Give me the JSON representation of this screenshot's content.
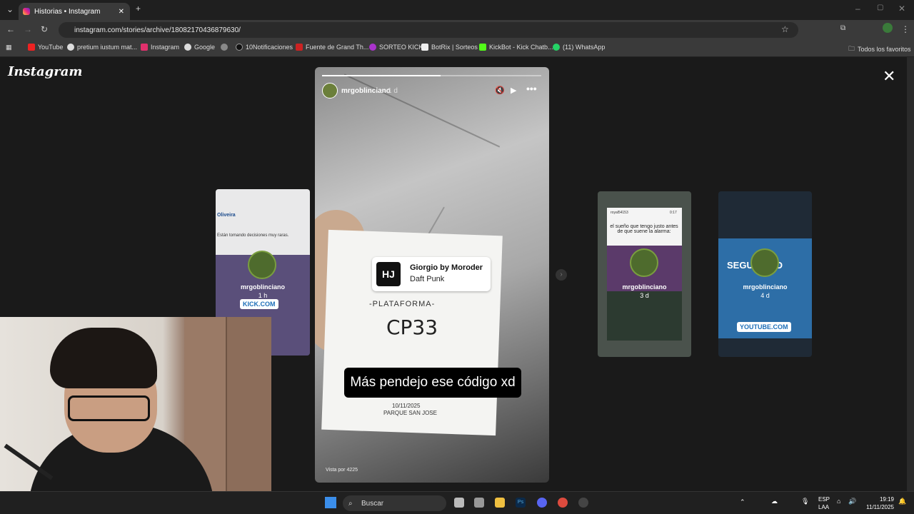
{
  "browser": {
    "tab_title": "Historias • Instagram",
    "url": "instagram.com/stories/archive/18082170436879630/",
    "bookmarks": [
      "YouTube",
      "pretium iustum mat...",
      "Instagram",
      "Google",
      "10Notificaciones",
      "Fuente de Grand Th...",
      "SORTEO KICK",
      "BotRix | Sorteos",
      "KickBot - Kick Chatb...",
      "(11) WhatsApp"
    ],
    "favorites_label": "Todos los favoritos"
  },
  "instagram": {
    "logo": "Instagram",
    "story": {
      "username": "mrgoblinciano",
      "time": "1 d",
      "progress": 0.54,
      "music_title": "Giorgio by Moroder",
      "music_artist": "Daft Punk",
      "ticket_platform": "-PLATAFORMA-",
      "ticket_code": "CP33",
      "caption": "Más pendejo ese código xd",
      "ticket_date": "10/11/2025",
      "ticket_place": "PARQUE SAN JOSE",
      "views": "Vista por 4225"
    },
    "side_stories": [
      {
        "username": "mrgoblinciano",
        "time": "1 h",
        "link": "KICK.COM",
        "header": "Oliveira",
        "body": "Están tomando decisiones muy raras."
      },
      {
        "username": "mrgoblinciano",
        "time": "3 d",
        "caption": "el sueño que tengo justo antes de que suene la alarma:",
        "top_left": "royal54153",
        "top_right": "0:17"
      },
      {
        "username": "mrgoblinciano",
        "time": "4 d",
        "link": "YOUTUBE.COM",
        "banner": "SEGURIDAD"
      }
    ]
  },
  "taskbar": {
    "search_placeholder": "Buscar",
    "lang_top": "ESP",
    "lang_bottom": "LAA",
    "time": "19:19",
    "date": "11/11/2025"
  }
}
